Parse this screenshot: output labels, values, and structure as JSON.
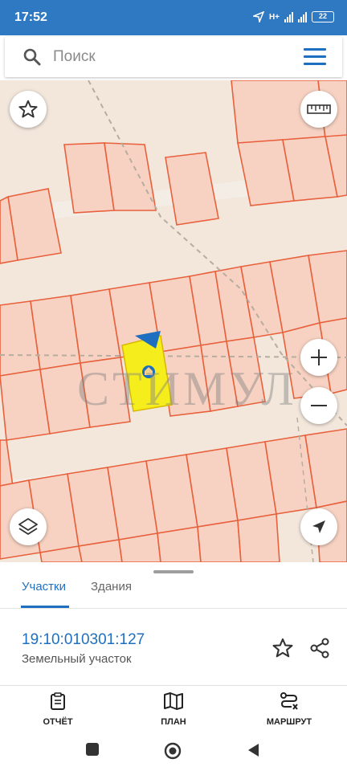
{
  "status_bar": {
    "time": "17:52",
    "network": "H+",
    "battery": "22"
  },
  "search": {
    "placeholder": "Поиск",
    "icon": "search-icon",
    "menu_icon": "hamburger-menu-icon"
  },
  "map": {
    "watermark": "СТИМУЛ",
    "selected_parcel_color": "#f5ee1c",
    "parcel_border_color": "#e8603c",
    "parcel_fill_color": "#f7d2c2",
    "background_color": "#f3e7dc",
    "controls": {
      "favorite_icon": "star-outline-icon",
      "ruler_icon": "ruler-icon",
      "zoom_in_icon": "plus-icon",
      "zoom_out_icon": "minus-icon",
      "layers_icon": "layers-icon",
      "location_icon": "navigation-arrow-icon"
    }
  },
  "sheet": {
    "tabs": [
      {
        "label": "Участки",
        "active": true
      },
      {
        "label": "Здания",
        "active": false
      }
    ],
    "result": {
      "cadastral_number": "19:10:010301:127",
      "type": "Земельный участок"
    }
  },
  "actions": [
    {
      "label": "ОТЧЁТ",
      "icon": "report-clipboard-icon"
    },
    {
      "label": "ПЛАН",
      "icon": "map-plan-icon"
    },
    {
      "label": "МАРШРУТ",
      "icon": "route-icon"
    }
  ],
  "colors": {
    "accent": "#1f6fc0",
    "status_bar": "#2f79c2"
  }
}
